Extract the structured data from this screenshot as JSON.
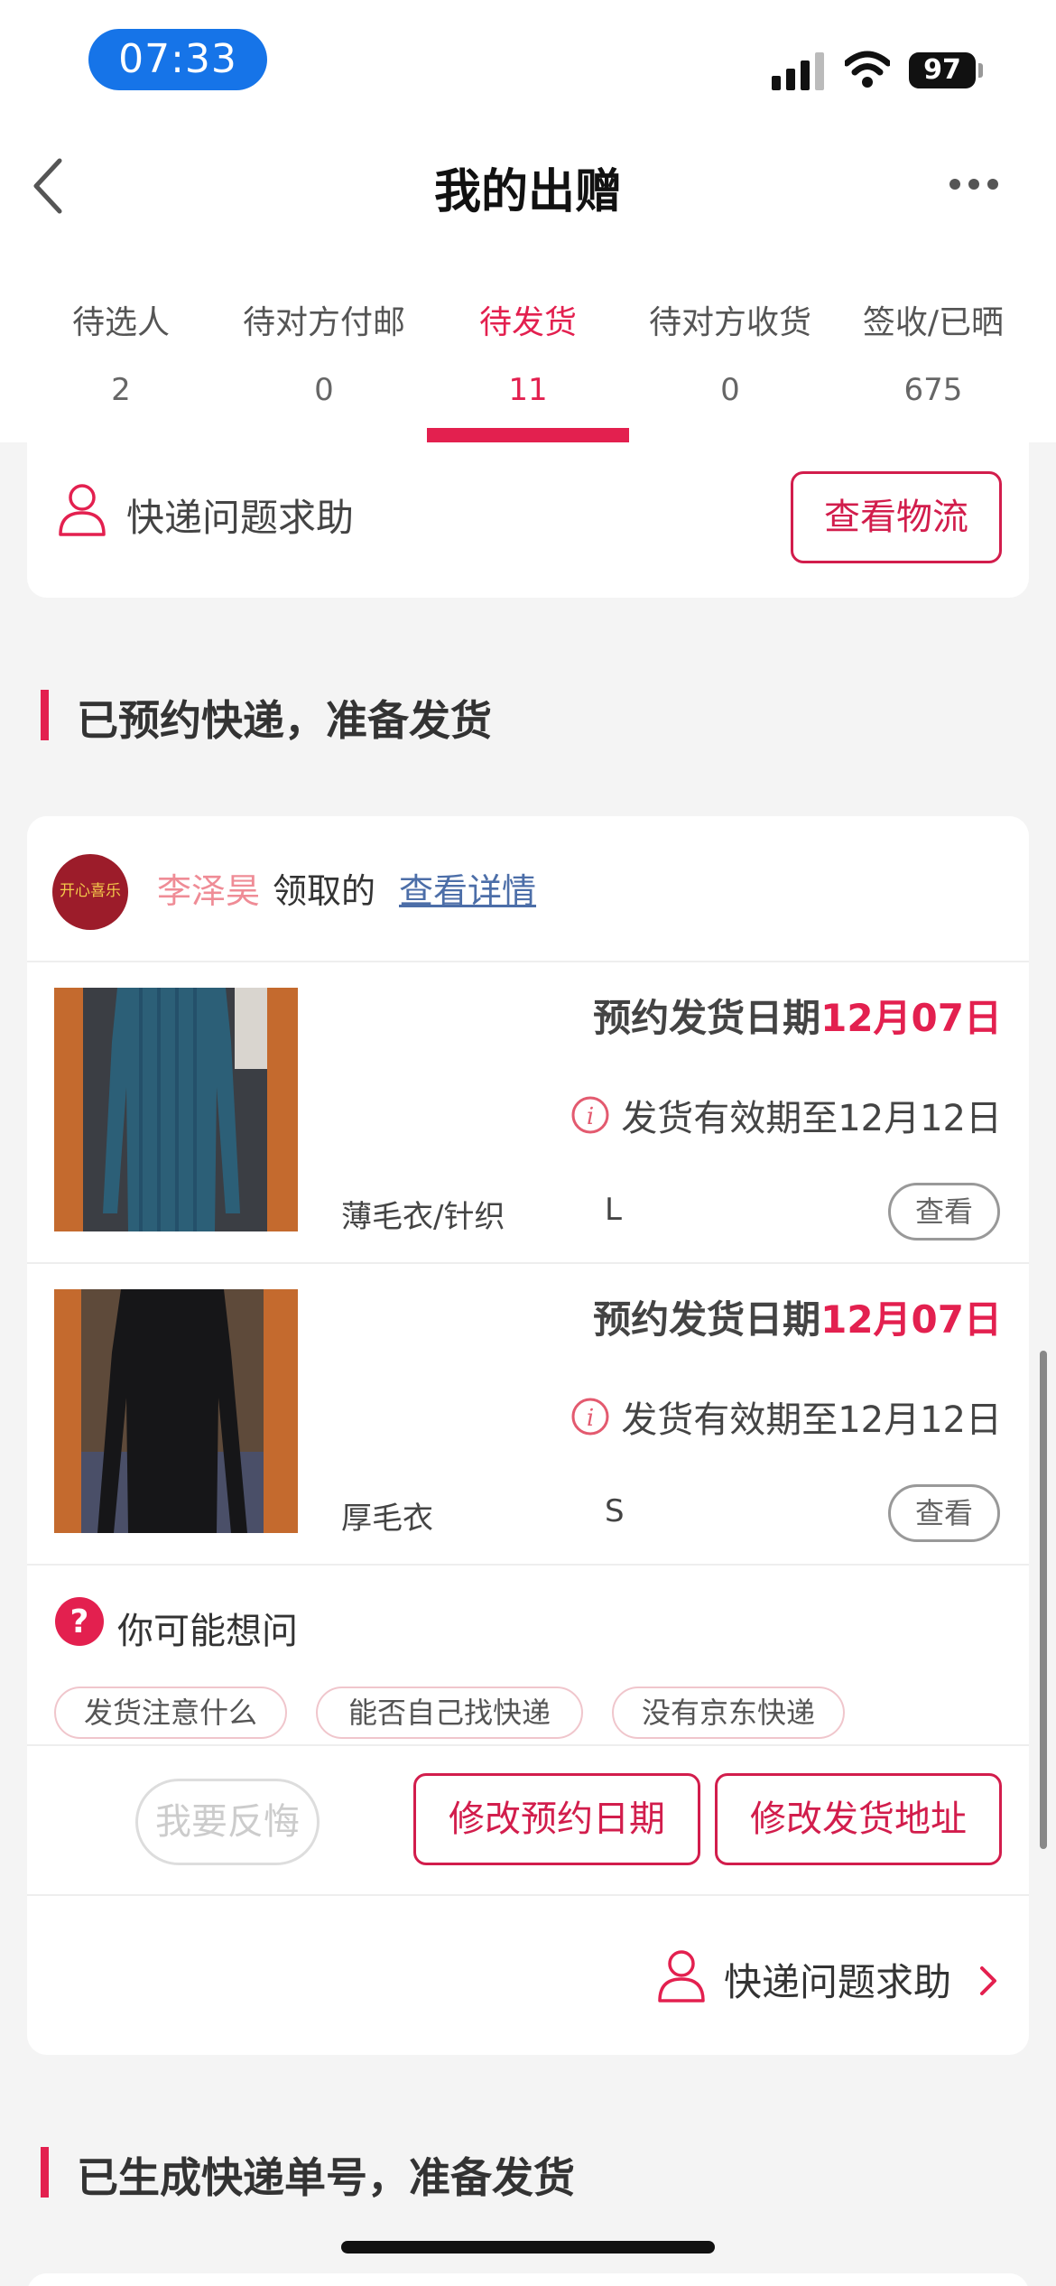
{
  "status_bar": {
    "time": "07:33",
    "battery": "97"
  },
  "nav": {
    "title": "我的出赠"
  },
  "tabs": [
    {
      "label": "待选人",
      "count": "2"
    },
    {
      "label": "待对方付邮",
      "count": "0"
    },
    {
      "label": "待发货",
      "count": "11",
      "active": true
    },
    {
      "label": "待对方收货",
      "count": "0"
    },
    {
      "label": "签收/已晒",
      "count": "675"
    }
  ],
  "top_card": {
    "help_label": "快递问题求助",
    "logistics_button": "查看物流"
  },
  "section_reserved": {
    "title": "已预约快递，准备发货"
  },
  "order": {
    "claimer_name": "李泽昊",
    "claimer_suffix": "领取的",
    "detail_link": "查看详情",
    "avatar_text": "开心喜乐",
    "items": [
      {
        "ship_date_label": "预约发货日期",
        "ship_date_value": "12月07日",
        "valid_until": "发货有效期至12月12日",
        "category": "薄毛衣/针织",
        "size": "L",
        "view_label": "查看",
        "color": "#2c5f77"
      },
      {
        "ship_date_label": "预约发货日期",
        "ship_date_value": "12月07日",
        "valid_until": "发货有效期至12月12日",
        "category": "厚毛衣",
        "size": "S",
        "view_label": "查看",
        "color": "#161618"
      }
    ],
    "faq": {
      "title": "你可能想问",
      "chips": [
        "发货注意什么",
        "能否自己找快递",
        "没有京东快递"
      ]
    },
    "actions": {
      "regret": "我要反悔",
      "modify_date": "修改预约日期",
      "modify_address": "修改发货地址"
    },
    "help_label": "快递问题求助"
  },
  "section_generated": {
    "title": "已生成快递单号，准备发货"
  },
  "colors": {
    "accent": "#e3204f",
    "link": "#4c6ea8",
    "status_pill": "#1674e8"
  }
}
